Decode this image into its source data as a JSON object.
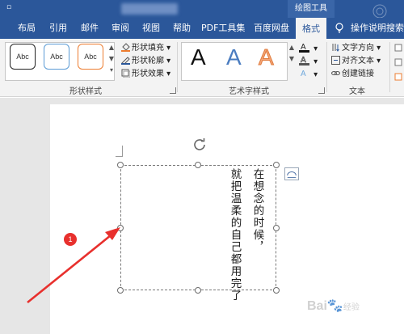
{
  "titlebar": {
    "qat_symbol": "▫",
    "context_tab": "绘图工具"
  },
  "tabs": [
    {
      "label": "布局"
    },
    {
      "label": "引用"
    },
    {
      "label": "邮件"
    },
    {
      "label": "审阅"
    },
    {
      "label": "视图"
    },
    {
      "label": "帮助"
    },
    {
      "label": "PDF工具集"
    },
    {
      "label": "百度网盘"
    },
    {
      "label": "格式",
      "active": true
    },
    {
      "label": "操作说明搜索"
    }
  ],
  "ribbon": {
    "shape_styles": {
      "presets": [
        "Abc",
        "Abc",
        "Abc"
      ],
      "preset_border_colors": [
        "#222222",
        "#5b9bd5",
        "#ed7d31"
      ],
      "fill_label": "形状填充",
      "outline_label": "形状轮廓",
      "effects_label": "形状效果",
      "group_label": "形状样式"
    },
    "wordart": {
      "letters": [
        "A",
        "A",
        "A"
      ],
      "letter_colors": [
        "#111111",
        "#4a7cc0",
        "#f4a67a"
      ],
      "group_label": "艺术字样式"
    },
    "text_group": {
      "direction_label": "文字方向",
      "align_label": "对齐文本",
      "link_label": "创建链接",
      "group_label": "文本"
    }
  },
  "document": {
    "column_right": "在想念的时候，",
    "column_left": "就把温柔的自己都用完了",
    "callout_number": "1"
  },
  "watermark": {
    "brand": "Bai",
    "brand_suffix": "经验"
  },
  "colors": {
    "accent": "#2b579a",
    "arrow": "#e8302d"
  }
}
